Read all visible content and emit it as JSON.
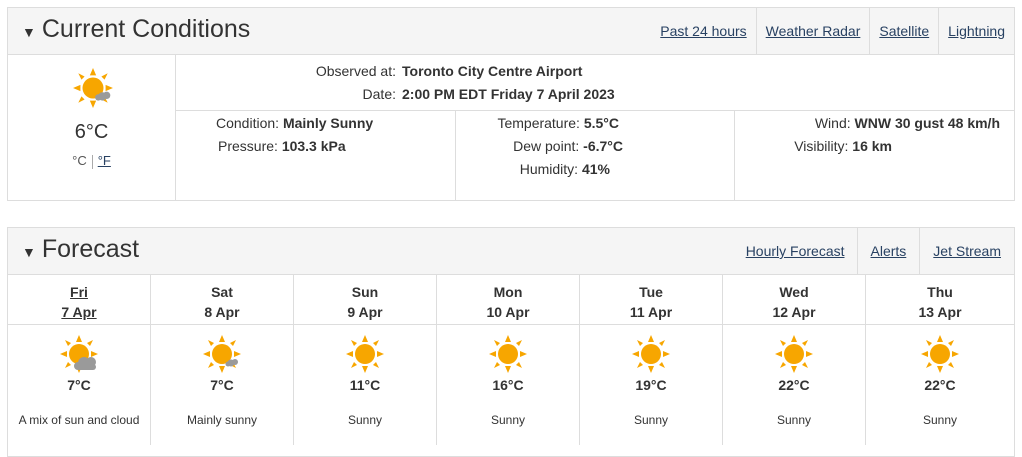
{
  "current": {
    "title": "Current Conditions",
    "links": [
      "Past 24 hours",
      "Weather Radar",
      "Satellite",
      "Lightning"
    ],
    "temp": "6°C",
    "unit_c": "°C",
    "unit_f": "°F",
    "observed_label": "Observed at:",
    "observed_value": "Toronto City Centre Airport",
    "date_label": "Date:",
    "date_value": "2:00 PM EDT Friday 7 April 2023",
    "condition_label": "Condition:",
    "condition_value": "Mainly Sunny",
    "pressure_label": "Pressure:",
    "pressure_value": "103.3 kPa",
    "temperature_label": "Temperature:",
    "temperature_value": "5.5°C",
    "dewpoint_label": "Dew point:",
    "dewpoint_value": "-6.7°C",
    "humidity_label": "Humidity:",
    "humidity_value": "41%",
    "wind_label": "Wind:",
    "wind_value": "WNW 30 gust 48 km/h",
    "visibility_label": "Visibility:",
    "visibility_value": "16 km",
    "icon": "sun-cloud-icon"
  },
  "forecast": {
    "title": "Forecast",
    "links": [
      "Hourly Forecast",
      "Alerts",
      "Jet Stream"
    ],
    "days": [
      {
        "day": "Fri",
        "date": "7 Apr",
        "temp": "7°C",
        "summary": "A mix of sun and cloud",
        "icon": "sun-cloud-icon"
      },
      {
        "day": "Sat",
        "date": "8 Apr",
        "temp": "7°C",
        "summary": "Mainly sunny",
        "icon": "sun-small-cloud-icon"
      },
      {
        "day": "Sun",
        "date": "9 Apr",
        "temp": "11°C",
        "summary": "Sunny",
        "icon": "sun-icon"
      },
      {
        "day": "Mon",
        "date": "10 Apr",
        "temp": "16°C",
        "summary": "Sunny",
        "icon": "sun-icon"
      },
      {
        "day": "Tue",
        "date": "11 Apr",
        "temp": "19°C",
        "summary": "Sunny",
        "icon": "sun-icon"
      },
      {
        "day": "Wed",
        "date": "12 Apr",
        "temp": "22°C",
        "summary": "Sunny",
        "icon": "sun-icon"
      },
      {
        "day": "Thu",
        "date": "13 Apr",
        "temp": "22°C",
        "summary": "Sunny",
        "icon": "sun-icon"
      }
    ]
  },
  "colors": {
    "link": "#284162",
    "sun": "#f7a600",
    "cloud": "#9a9a9a"
  }
}
